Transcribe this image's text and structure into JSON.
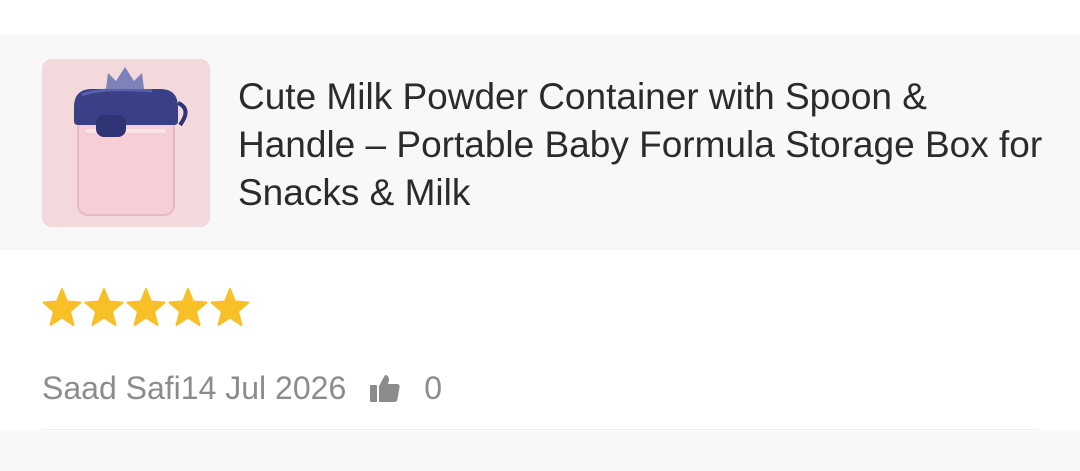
{
  "product": {
    "title": "Cute Milk Powder Container with Spoon & Handle – Portable Baby Formula Storage Box for Snacks & Milk",
    "thumbnail_icon": "milk-powder-container-image"
  },
  "review": {
    "rating": 5,
    "rating_max": 5,
    "star_color": "#F6C026",
    "reviewer": "Saad Safi",
    "date": "14 Jul 2026",
    "like_icon": "thumbs-up-icon",
    "likes": "0"
  },
  "colors": {
    "card_background": "#F8F8F8",
    "title_text": "#2B2B2B",
    "meta_text": "#8C8C8C",
    "thumbnail_background": "#F3D8DC"
  }
}
